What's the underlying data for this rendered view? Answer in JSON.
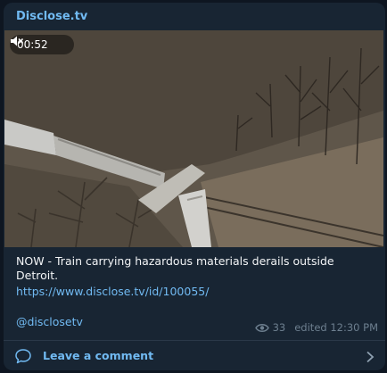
{
  "post": {
    "channel_name": "Disclose.tv",
    "video": {
      "duration": "00:52",
      "muted_icon": "muted-speaker-icon"
    },
    "caption": "NOW - Train carrying hazardous materials derails outside Detroit.",
    "link": "https://www.disclose.tv/id/100055/",
    "handle": "@disclosetv",
    "views": "33",
    "edited": "edited 12:30 PM"
  },
  "footer": {
    "comment_label": "Leave a comment",
    "comment_icon": "comment-bubble-icon",
    "chevron_icon": "chevron-right-icon"
  },
  "colors": {
    "background": "#0e1621",
    "bubble": "#182533",
    "accent": "#71baf2",
    "text": "#f2f4f6",
    "meta": "#6d7f8f"
  }
}
